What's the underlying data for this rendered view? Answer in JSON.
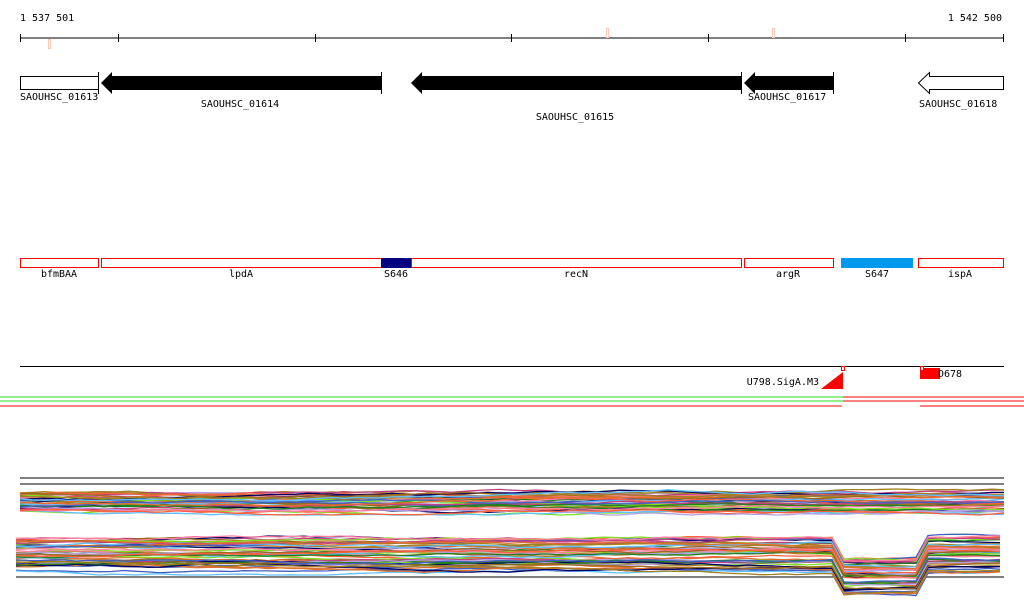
{
  "ruler": {
    "start": "1 537 501",
    "end": "1 542 500"
  },
  "genes": [
    {
      "name": "SAOUHSC_01613",
      "strand": "none",
      "fill": "#ffffff"
    },
    {
      "name": "SAOUHSC_01614",
      "strand": "-",
      "fill": "#000000"
    },
    {
      "name": "SAOUHSC_01615",
      "strand": "-",
      "fill": "#000000"
    },
    {
      "name": "SAOUHSC_01617",
      "strand": "-",
      "fill": "#000000"
    },
    {
      "name": "SAOUHSC_01618",
      "strand": "-",
      "fill": "#ffffff"
    }
  ],
  "segments": [
    {
      "name": "bfmBAA",
      "fill": "#ffffff"
    },
    {
      "name": "lpdA",
      "fill": "#ffffff"
    },
    {
      "name": "S646",
      "fill": "#000080"
    },
    {
      "name": "recN",
      "fill": "#ffffff"
    },
    {
      "name": "argR",
      "fill": "#ffffff"
    },
    {
      "name": "S647",
      "fill": "#0099ee"
    },
    {
      "name": "ispA",
      "fill": "#ffffff"
    }
  ],
  "features": [
    {
      "name": "U798.SigA.M3",
      "color": "#ff0000"
    },
    {
      "name": "D678",
      "color": "#ff0000"
    }
  ]
}
